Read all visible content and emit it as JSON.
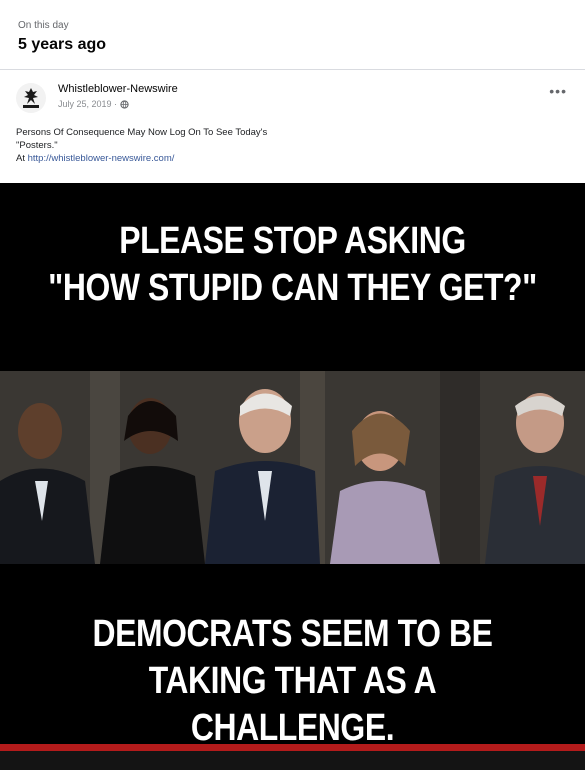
{
  "memory": {
    "label": "On this day",
    "when": "5 years ago"
  },
  "post": {
    "author": "Whistleblower-Newswire",
    "date": "July 25, 2019 ·",
    "text_line1": "Persons Of Consequence May Now Log On To See Today's",
    "text_line2": "\"Posters.\"",
    "link_prefix": "At ",
    "link_text": "http://whistleblower-newswire.com/"
  },
  "meme": {
    "top_line1": "PLEASE STOP ASKING",
    "top_line2": "\"HOW STUPID CAN THEY GET?\"",
    "bottom_line1": "DEMOCRATS SEEM TO BE",
    "bottom_line2": "TAKING THAT AS A CHALLENGE."
  },
  "icons": {
    "avatar": "eagle-logo-icon",
    "audience": "globe-icon",
    "more": "more-options-icon"
  },
  "colors": {
    "link": "#385898",
    "meme_background": "#000000",
    "stripe": "#b31b1b"
  }
}
